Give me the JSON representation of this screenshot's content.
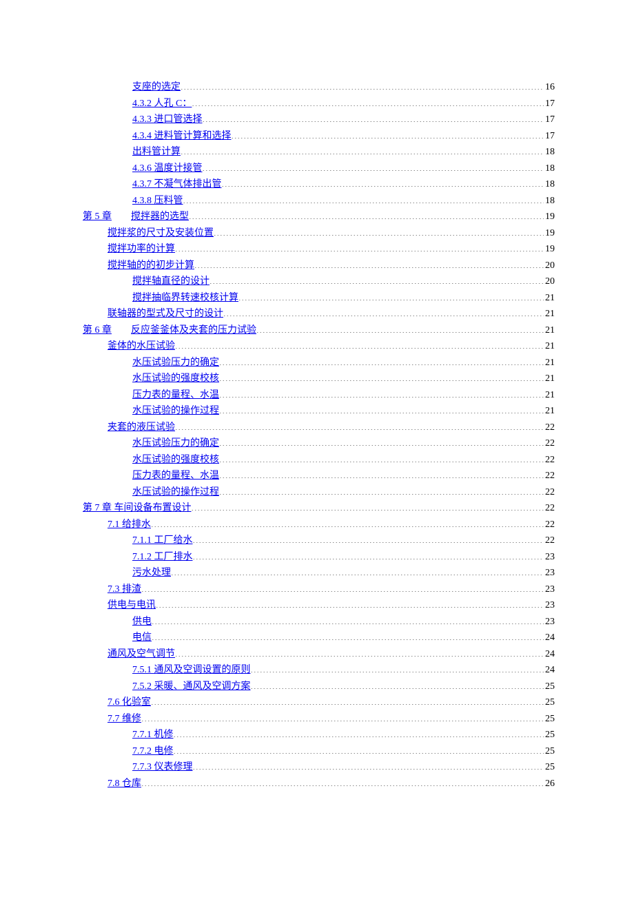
{
  "toc": [
    {
      "level": 3,
      "text": "支座的选定",
      "page": "16"
    },
    {
      "level": 3,
      "text": "4.3.2  人孔 C：",
      "page": "17"
    },
    {
      "level": 3,
      "text": "4.3.3  进口管选择",
      "page": "17"
    },
    {
      "level": 3,
      "text": "4.3.4 进料管计算和选择",
      "page": "17"
    },
    {
      "level": 3,
      "text": "出料管计算",
      "page": "18"
    },
    {
      "level": 3,
      "text": "4.3.6  温度计接管",
      "page": "18"
    },
    {
      "level": 3,
      "text": "4.3.7  不凝气体排出管",
      "page": "18"
    },
    {
      "level": 3,
      "text": "4.3.8  压料管",
      "page": "18"
    },
    {
      "level": 1,
      "prefix": "第 5 章",
      "text": "搅拌器的选型",
      "page": "19"
    },
    {
      "level": 2,
      "text": "搅拌浆的尺寸及安装位置",
      "page": "19"
    },
    {
      "level": 2,
      "text": "搅拌功率的计算",
      "page": "19"
    },
    {
      "level": 2,
      "text": "搅拌轴的的初步计算",
      "page": "20"
    },
    {
      "level": 3,
      "text": "搅拌轴直径的设计",
      "page": "20"
    },
    {
      "level": 3,
      "text": "搅拌抽临界转速校核计算",
      "page": "21"
    },
    {
      "level": 2,
      "text": "联轴器的型式及尺寸的设计",
      "page": "21"
    },
    {
      "level": 1,
      "prefix": "第 6 章",
      "text": "反应釜釜体及夹套的压力试验",
      "page": "21"
    },
    {
      "level": 2,
      "text": "釜体的水压试验",
      "page": "21"
    },
    {
      "level": 3,
      "text": "水压试验压力的确定",
      "page": "21"
    },
    {
      "level": 3,
      "text": "水压试验的强度校核",
      "page": "21"
    },
    {
      "level": 3,
      "text": "压力表的量程、水温",
      "page": "21"
    },
    {
      "level": 3,
      "text": "水压试验的操作过程",
      "page": "21"
    },
    {
      "level": 2,
      "text": "夹套的液压试验",
      "page": "22"
    },
    {
      "level": 3,
      "text": "水压试验压力的确定",
      "page": "22"
    },
    {
      "level": 3,
      "text": "水压试验的强度校核",
      "page": "22"
    },
    {
      "level": 3,
      "text": "压力表的量程、水温",
      "page": "22"
    },
    {
      "level": 3,
      "text": "水压试验的操作过程",
      "page": "22"
    },
    {
      "level": 1,
      "text": "第 7 章  车间设备布置设计",
      "page": "22"
    },
    {
      "level": 2,
      "text": "7.1  给排水",
      "page": "22"
    },
    {
      "level": 3,
      "text": "7.1.1  工厂给水",
      "page": "22"
    },
    {
      "level": 3,
      "text": "7.1.2  工厂排水",
      "page": "23"
    },
    {
      "level": 3,
      "text": "污水处理",
      "page": "23"
    },
    {
      "level": 2,
      "text": "7.3  排渣",
      "page": "23"
    },
    {
      "level": 2,
      "text": "供电与电讯",
      "page": "23"
    },
    {
      "level": 3,
      "text": "供电",
      "page": "23"
    },
    {
      "level": 3,
      "text": "电信",
      "page": "24"
    },
    {
      "level": 2,
      "text": "通风及空气调节",
      "page": "24"
    },
    {
      "level": 3,
      "text": "7.5.1  通风及空调设置的原则",
      "page": "24"
    },
    {
      "level": 3,
      "text": "7.5.2  采暖、通风及空调方案",
      "page": "25"
    },
    {
      "level": 2,
      "text": "7.6  化验室",
      "page": "25"
    },
    {
      "level": 2,
      "text": "7.7  维修",
      "page": "25"
    },
    {
      "level": 3,
      "text": "7.7.1  机修",
      "page": "25"
    },
    {
      "level": 3,
      "text": "7.7.2  电修",
      "page": "25"
    },
    {
      "level": 3,
      "text": "7.7.3  仪表修理",
      "page": "25"
    },
    {
      "level": 2,
      "text": "7.8  仓库",
      "page": "26"
    }
  ]
}
